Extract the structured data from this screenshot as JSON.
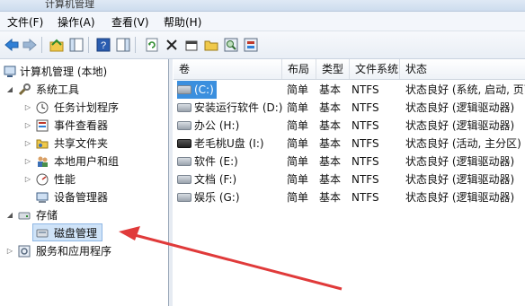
{
  "window": {
    "title": "计算机管理"
  },
  "menu": [
    "文件(F)",
    "操作(A)",
    "查看(V)",
    "帮助(H)"
  ],
  "toolbar": {
    "icons": [
      "back-icon",
      "forward-icon",
      "up-folder-icon",
      "show-hide-tree-icon",
      "help-icon",
      "properties-pane-icon",
      "refresh-icon",
      "delete-icon",
      "properties-icon",
      "open-folder-icon",
      "find-icon",
      "settings-icon"
    ]
  },
  "tree": {
    "root": "计算机管理 (本地)",
    "system_tools": "系统工具",
    "task_scheduler": "任务计划程序",
    "event_viewer": "事件查看器",
    "shared_folders": "共享文件夹",
    "local_users": "本地用户和组",
    "performance": "性能",
    "device_manager": "设备管理器",
    "storage": "存储",
    "disk_management": "磁盘管理",
    "services": "服务和应用程序"
  },
  "volumes": {
    "columns": [
      "卷",
      "布局",
      "类型",
      "文件系统",
      "状态"
    ],
    "rows": [
      {
        "name": "(C:)",
        "layout": "简单",
        "type": "基本",
        "fs": "NTFS",
        "status": "状态良好 (系统, 启动, 页面"
      },
      {
        "name": "安装运行软件 (D:)",
        "layout": "简单",
        "type": "基本",
        "fs": "NTFS",
        "status": "状态良好 (逻辑驱动器)"
      },
      {
        "name": "办公 (H:)",
        "layout": "简单",
        "type": "基本",
        "fs": "NTFS",
        "status": "状态良好 (逻辑驱动器)"
      },
      {
        "name": "老毛桃U盘 (I:)",
        "layout": "简单",
        "type": "基本",
        "fs": "NTFS",
        "status": "状态良好 (活动, 主分区)"
      },
      {
        "name": "软件 (E:)",
        "layout": "简单",
        "type": "基本",
        "fs": "NTFS",
        "status": "状态良好 (逻辑驱动器)"
      },
      {
        "name": "文档 (F:)",
        "layout": "简单",
        "type": "基本",
        "fs": "NTFS",
        "status": "状态良好 (逻辑驱动器)"
      },
      {
        "name": "娱乐 (G:)",
        "layout": "简单",
        "type": "基本",
        "fs": "NTFS",
        "status": "状态良好 (逻辑驱动器)"
      }
    ]
  },
  "colors": {
    "selection": "#3b8fde",
    "annotation_arrow": "#e03a3a"
  }
}
